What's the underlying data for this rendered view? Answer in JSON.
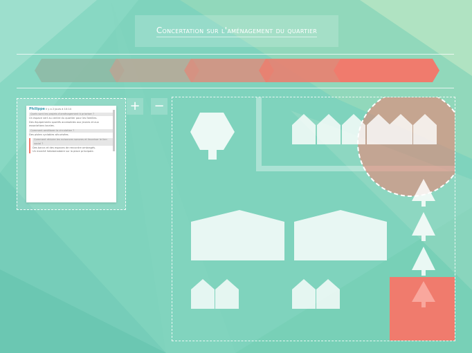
{
  "page": {
    "title": "Concertation sur l'aménagement du quartier"
  },
  "colors": {
    "background": "#7fd3bd",
    "accent": "#f07b6d",
    "step_colors": [
      "#8fb8a5",
      "#c2a191",
      "#dc8d7e",
      "#ea8070",
      "#f07b6d"
    ]
  },
  "steps_count": 5,
  "zoom": {
    "in_label": "+",
    "out_label": "−"
  },
  "comments": {
    "author": "Philippe",
    "meta": "il y a 2 jours à 10:14",
    "threads": [
      {
        "question": "Quels sont les projets d'aménagement à prioriser ?",
        "answers": [
          "Un espace vert au centre du quartier pour les familles.",
          "Des équipements sportifs accessibles aux jeunes et aux associations locales."
        ]
      },
      {
        "question": "Comment améliorer la circulation ?",
        "answers": [
          "Des pistes cyclables sécurisées."
        ]
      },
      {
        "question": "Comment réduire les nuisances sonores et favoriser le lien social ?",
        "answers": [
          "Des bancs et des espaces de rencontre ombragés.",
          "Un marché hebdomadaire sur la place principale."
        ]
      }
    ]
  },
  "map": {
    "icons": [
      "tree-icon",
      "house-icon",
      "building-icon",
      "pine-tree-icon",
      "selection-circle"
    ]
  }
}
